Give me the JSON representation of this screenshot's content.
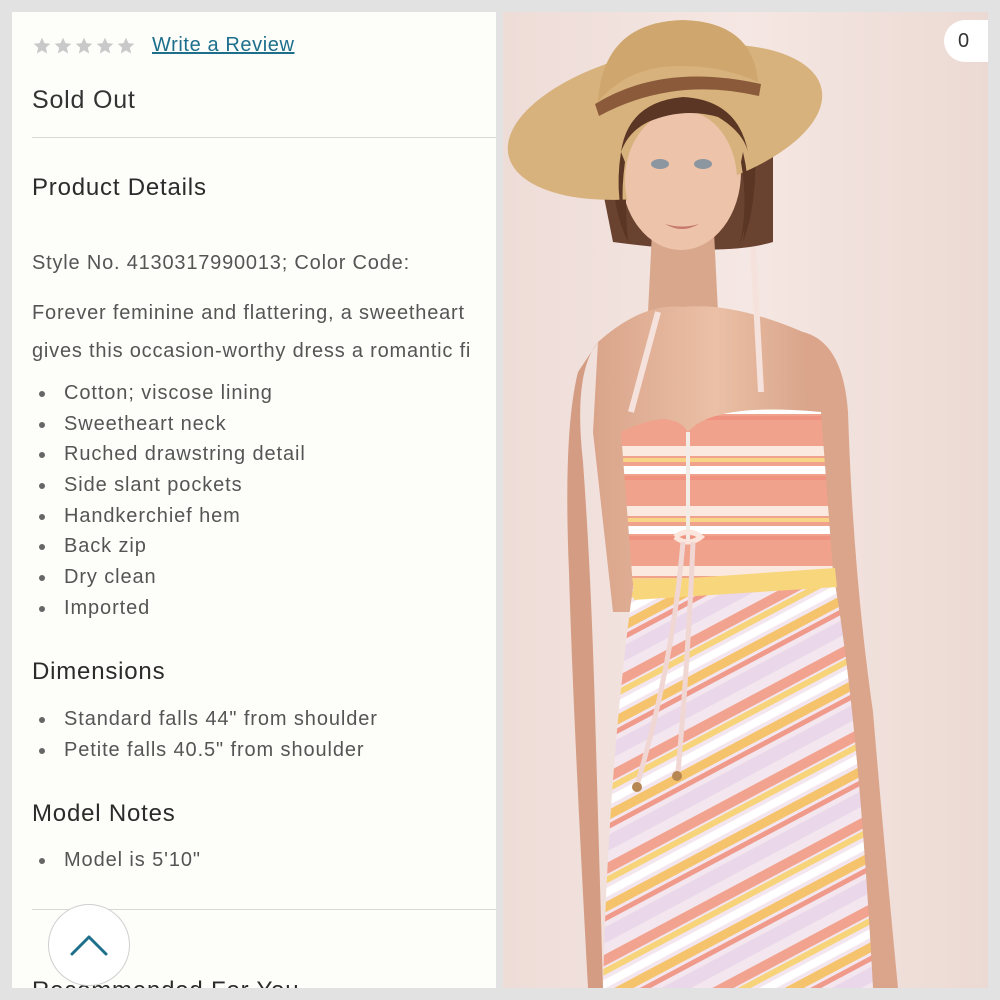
{
  "rating": {
    "star_count": 5,
    "filled_stars": 0,
    "star_color": "#c9c9c9",
    "write_review_label": "Write a Review",
    "link_color": "#1d6f8c"
  },
  "availability": "Sold Out",
  "product_details": {
    "heading": "Product Details",
    "style_line": "Style No. 4130317990013; Color Code:",
    "description_lines": [
      "Forever feminine and flattering, a sweetheart",
      "gives this occasion-worthy dress a romantic fi"
    ],
    "bullets": [
      "Cotton; viscose lining",
      "Sweetheart neck",
      "Ruched drawstring detail",
      "Side slant pockets",
      "Handkerchief hem",
      "Back zip",
      "Dry clean",
      "Imported"
    ]
  },
  "dimensions": {
    "heading": "Dimensions",
    "bullets": [
      "Standard falls 44\" from shoulder",
      "Petite falls 40.5\" from shoulder"
    ]
  },
  "model_notes": {
    "heading": "Model Notes",
    "bullets": [
      "Model is 5'10\""
    ]
  },
  "next_section_heading": "Recommended For You",
  "scroll_top_icon": "chevron-up-icon",
  "image_counter_text": "0"
}
